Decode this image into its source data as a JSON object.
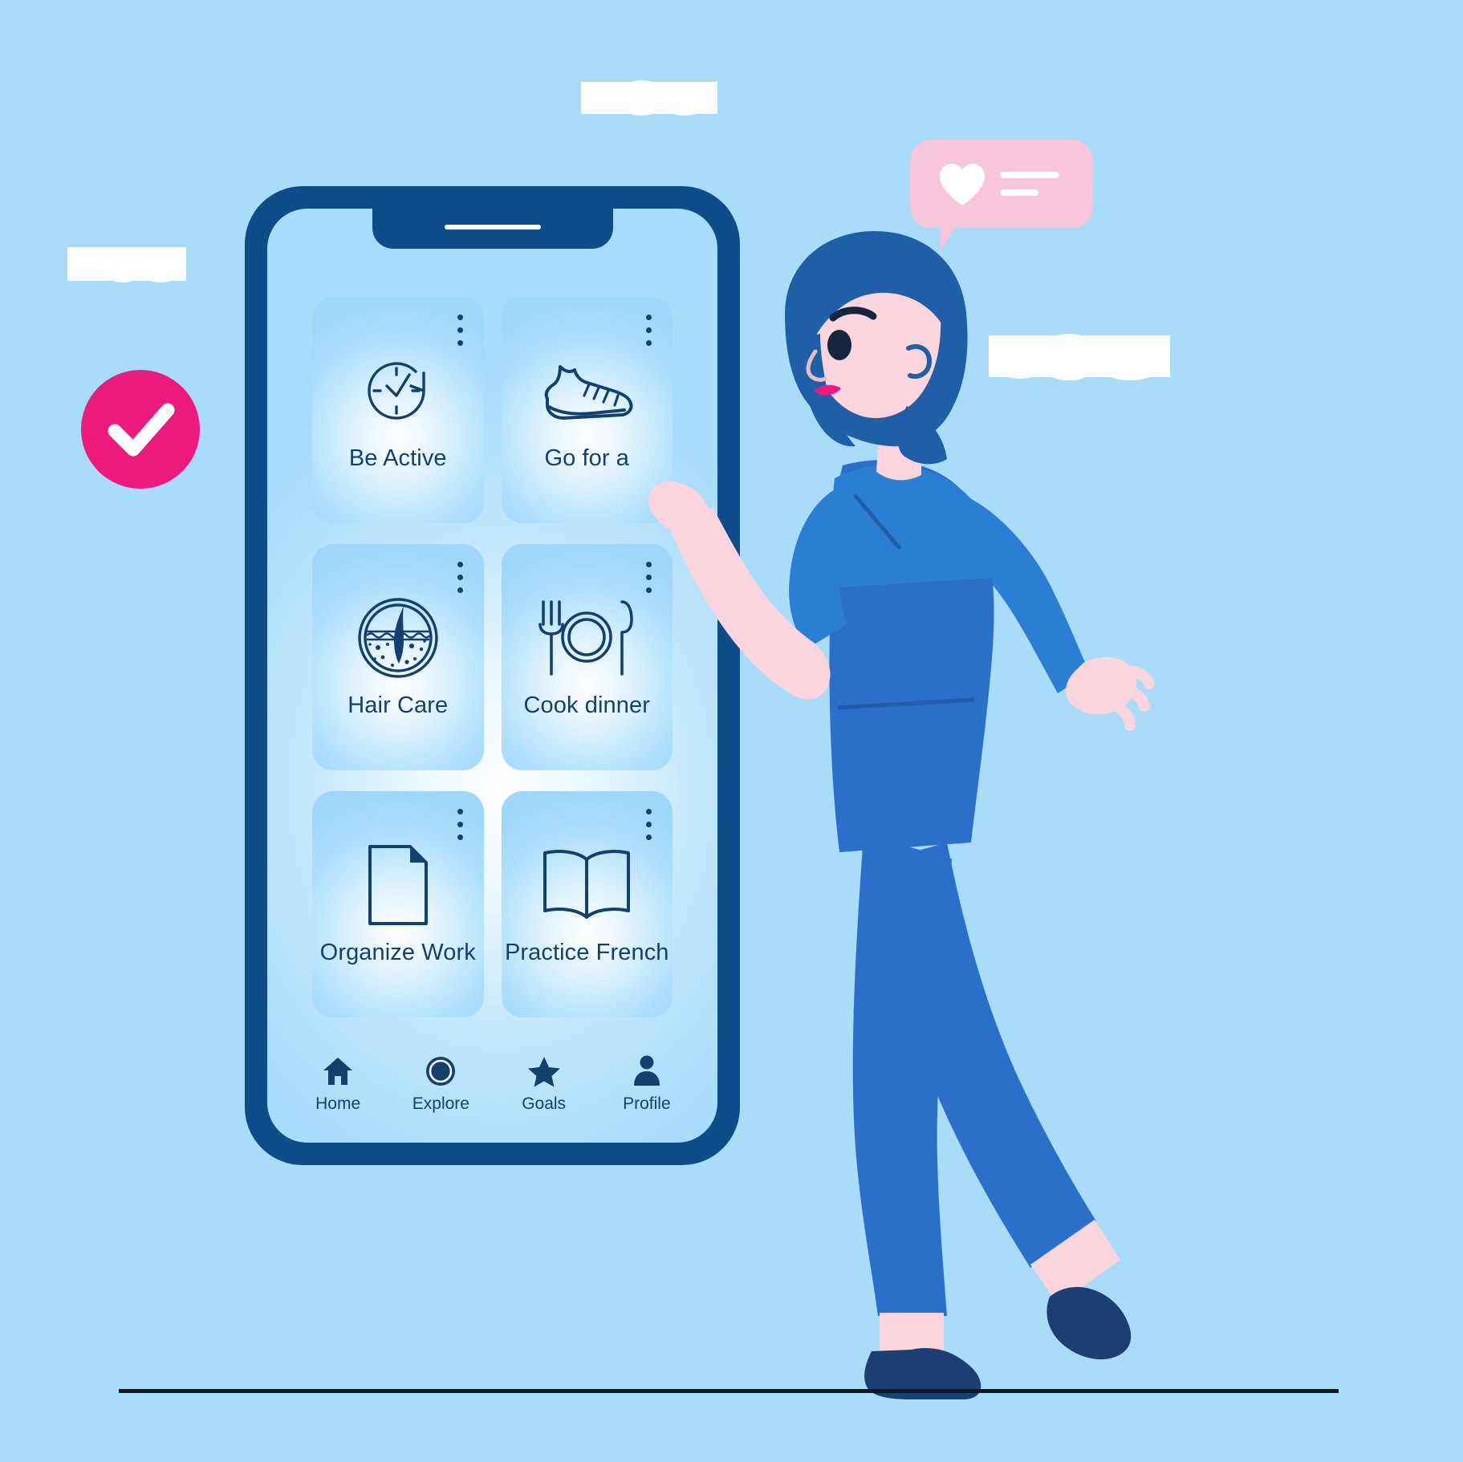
{
  "scene": {
    "title": "Habit tracker mobile app illustration",
    "background_color": "#a8dcf8",
    "accent_pink": "#ec1a7d",
    "bubble_pink": "#f8c6da",
    "deep_blue": "#14406e",
    "phone_frame_color": "#0f4c8a",
    "garment_blue": "#2a6fc9",
    "skin_color": "#fbd5dd"
  },
  "badge": {
    "name": "completed-check-badge",
    "icon": "check-icon",
    "color": "#ec1a7d"
  },
  "speech_bubble": {
    "name": "like-speech-bubble",
    "icon": "heart-icon",
    "lines": 2,
    "color": "#f8c6da"
  },
  "phone": {
    "notch": {
      "speaker": true
    },
    "screen": {
      "cards": [
        {
          "label": "Be Active",
          "icon": "clock-refresh-icon",
          "menu": "more-options-icon"
        },
        {
          "label": "Go for a",
          "icon": "sneaker-icon",
          "menu": "more-options-icon"
        },
        {
          "label": "Hair Care",
          "icon": "hair-follicle-icon",
          "menu": "more-options-icon"
        },
        {
          "label": "Cook dinner",
          "icon": "cutlery-plate-icon",
          "menu": "more-options-icon"
        },
        {
          "label": "Organize Work",
          "icon": "document-icon",
          "menu": "more-options-icon"
        },
        {
          "label": "Practice French",
          "icon": "open-book-icon",
          "menu": "more-options-icon"
        }
      ],
      "navbar": [
        {
          "label": "Home",
          "icon": "home-icon"
        },
        {
          "label": "Explore",
          "icon": "compass-ring-icon"
        },
        {
          "label": "Goals",
          "icon": "star-icon"
        },
        {
          "label": "Profile",
          "icon": "person-icon"
        }
      ]
    }
  },
  "clouds": [
    {
      "name": "cloud-top-center"
    },
    {
      "name": "cloud-left"
    },
    {
      "name": "cloud-right"
    }
  ],
  "character": {
    "name": "woman-tapping-phone",
    "hair_color": "#1f5fa8",
    "top_color": "#2a7fd4",
    "overall_color": "#2a6fc9",
    "shoe_color": "#1b3f72"
  }
}
